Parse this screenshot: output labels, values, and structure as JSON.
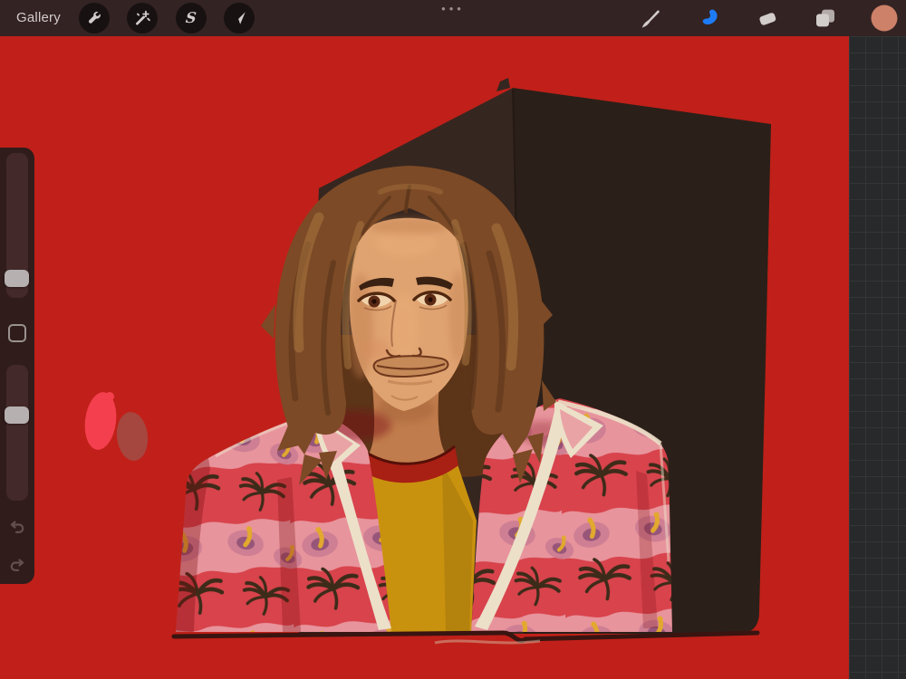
{
  "topbar": {
    "gallery_label": "Gallery",
    "menu_dots": "•••",
    "selection_letter": "S",
    "tools_left": [
      "actions-wrench",
      "adjustments-magic-wand",
      "selection-s",
      "transform-arrow"
    ],
    "tools_right": [
      "paint-brush",
      "smudge-finger",
      "eraser",
      "layers",
      "active-color"
    ],
    "active_tool": "smudge-finger",
    "active_color": "#cd8168"
  },
  "sidebar": {
    "brush_size_handle_pct": 87,
    "opacity_handle_pct": 37,
    "controls": [
      "brush-size-slider",
      "modify-button",
      "opacity-slider",
      "undo",
      "redo"
    ]
  },
  "canvas": {
    "background": "#c02019",
    "paint_swatches": [
      "#f43f4e",
      "#9e5049"
    ],
    "artwork": "Portrait of a long-haired figure in a red tropical shirt with hibiscus and palm print over a mustard tee, standing before a dark box on a red background"
  },
  "colors": {
    "topbar_bg": "#342323",
    "topbar_btn": "#181112",
    "icon_gray": "#d2cccb",
    "smudge_blue": "#1e7bf6",
    "dots_gray": "#9b8c8a",
    "canvas_red": "#c02019",
    "offcanvas_bg": "#28292b",
    "grid_line": "#333537",
    "panel_bg": "#2f1c1b",
    "track_bg": "#44292a",
    "handle_gray": "#b6b1b0",
    "square_stroke": "#9a9290",
    "undo_arrow": "#63504d",
    "box_left": "#362620",
    "box_right": "#2b1f19",
    "box_edge": "#20160f",
    "desk_line": "#3a1410",
    "blob_red": "#f43f4e",
    "blob_mud": "#9e5049",
    "hair_base": "#7c4a26",
    "hair_dark": "#59331a",
    "hair_light": "#a97740",
    "hair_back": "#5c3418",
    "skin": "#dfa371",
    "skin_shadow": "#c07c4c",
    "skin_deep": "#a9673c",
    "brow_brown": "#3a2112",
    "eye_white": "#f0d3ac",
    "iris_brown": "#5c2a14",
    "line_brown": "#6f381c",
    "tee_yellow": "#c9920e",
    "tee_shadow": "#a2770c",
    "collar_red": "#a81f14",
    "collar_dark": "#551008",
    "shirt_red": "#d8434c",
    "shirt_pink": "#e8949c",
    "flower_pink": "#cd7d92",
    "flower_core": "#8d4f74",
    "stamen": "#e2a92e",
    "palm_dark": "#3d2b19",
    "lapel_cream": "#ece0c9",
    "shadow_red": "#7c0f12",
    "scribble": "#d8c9b0"
  }
}
